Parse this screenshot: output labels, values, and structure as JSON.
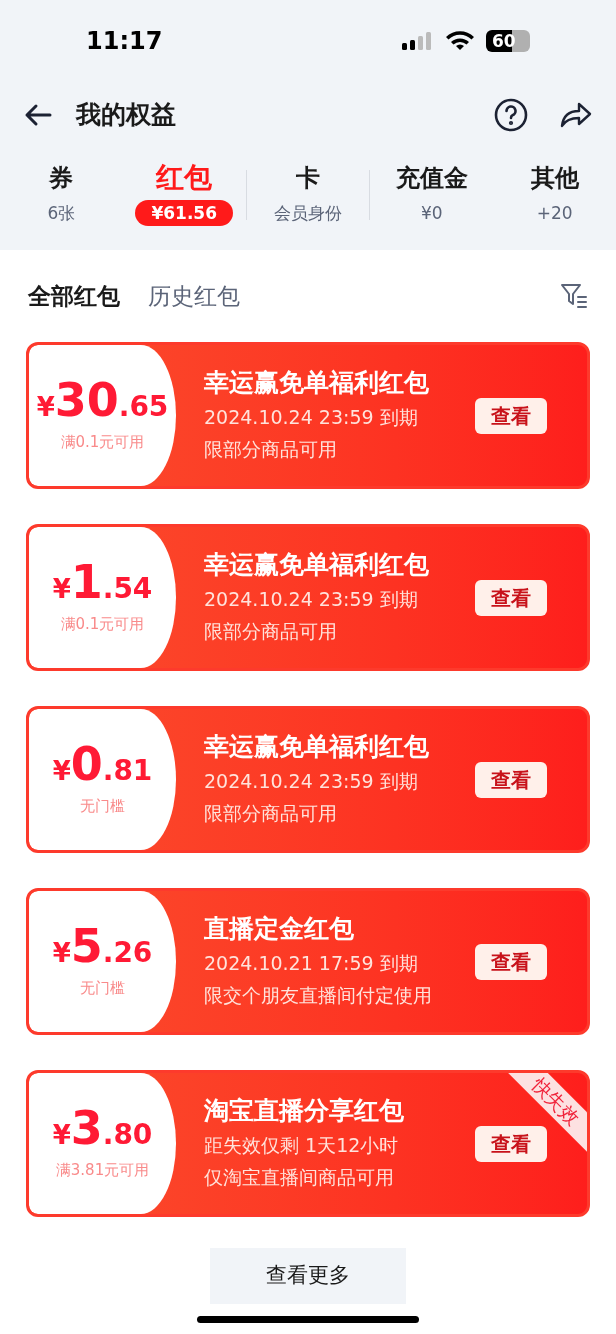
{
  "status_bar": {
    "time": "11:17",
    "battery": "60"
  },
  "header": {
    "title": "我的权益"
  },
  "categories": [
    {
      "name": "券",
      "value": "6张",
      "selected": false
    },
    {
      "name": "红包",
      "value": "¥61.56",
      "selected": true
    },
    {
      "name": "卡",
      "value": "会员身份",
      "selected": false
    },
    {
      "name": "充值金",
      "value": "¥0",
      "selected": false
    },
    {
      "name": "其他",
      "value": "+20",
      "selected": false
    }
  ],
  "tabs": [
    {
      "label": "全部红包",
      "selected": true
    },
    {
      "label": "历史红包",
      "selected": false
    }
  ],
  "packets": [
    {
      "currency": "¥",
      "integer": "30",
      "decimal": ".65",
      "condition": "满0.1元可用",
      "title": "幸运赢免单福利红包",
      "expiry": "2024.10.24 23:59 到期",
      "scope": "限部分商品可用",
      "action": "查看"
    },
    {
      "currency": "¥",
      "integer": "1",
      "decimal": ".54",
      "condition": "满0.1元可用",
      "title": "幸运赢免单福利红包",
      "expiry": "2024.10.24 23:59 到期",
      "scope": "限部分商品可用",
      "action": "查看"
    },
    {
      "currency": "¥",
      "integer": "0",
      "decimal": ".81",
      "condition": "无门槛",
      "title": "幸运赢免单福利红包",
      "expiry": "2024.10.24 23:59 到期",
      "scope": "限部分商品可用",
      "action": "查看"
    },
    {
      "currency": "¥",
      "integer": "5",
      "decimal": ".26",
      "condition": "无门槛",
      "title": "直播定金红包",
      "expiry": "2024.10.21 17:59 到期",
      "scope": "限交个朋友直播间付定使用",
      "action": "查看"
    },
    {
      "currency": "¥",
      "integer": "3",
      "decimal": ".80",
      "condition": "满3.81元可用",
      "title": "淘宝直播分享红包",
      "expiry": "距失效仅剩 1天12小时",
      "scope": "仅淘宝直播间商品可用",
      "action": "查看",
      "badge": "快失效"
    }
  ],
  "more_button": "查看更多"
}
